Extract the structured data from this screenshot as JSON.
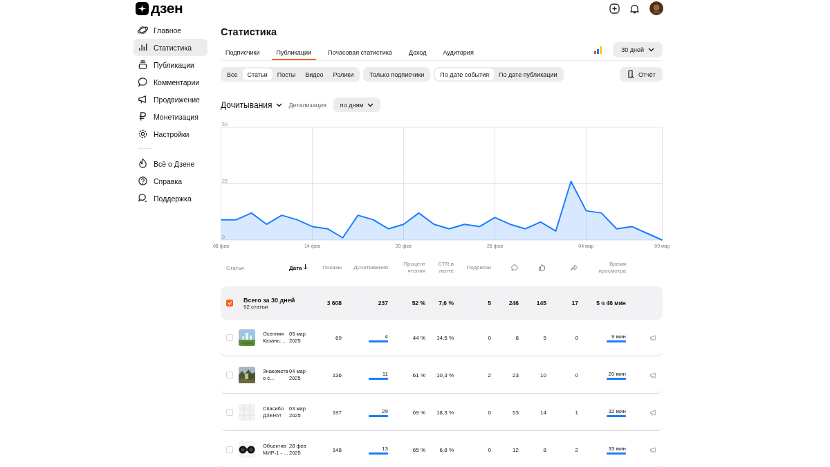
{
  "header": {
    "logo": "дзен"
  },
  "sidebar": {
    "items": [
      {
        "label": "Главное",
        "selected": false
      },
      {
        "label": "Статистика",
        "selected": true
      },
      {
        "label": "Публикации",
        "selected": false
      },
      {
        "label": "Комментарии",
        "selected": false
      },
      {
        "label": "Продвижение",
        "selected": false
      },
      {
        "label": "Монетизация",
        "selected": false
      },
      {
        "label": "Настройки",
        "selected": false
      }
    ],
    "footer_items": [
      {
        "label": "Всё о Дзене"
      },
      {
        "label": "Справка"
      },
      {
        "label": "Поддержка"
      }
    ]
  },
  "title": "Статистика",
  "tabs": [
    {
      "label": "Подписчики",
      "selected": false
    },
    {
      "label": "Публикации",
      "selected": true
    },
    {
      "label": "Почасовая статистика",
      "selected": false
    },
    {
      "label": "Доход",
      "selected": false
    },
    {
      "label": "Аудитория",
      "selected": false
    }
  ],
  "period": "30 дней",
  "type_filter": [
    {
      "label": "Все",
      "selected": false
    },
    {
      "label": "Статьи",
      "selected": true
    },
    {
      "label": "Посты",
      "selected": false
    },
    {
      "label": "Видео",
      "selected": false
    },
    {
      "label": "Ролики",
      "selected": false
    }
  ],
  "subscribers_only": {
    "label": "Только подписчики",
    "selected": false
  },
  "date_mode": [
    {
      "label": "По дате события",
      "selected": true
    },
    {
      "label": "По дате публикации",
      "selected": false
    }
  ],
  "report_button": "Отчёт",
  "metric": "Дочитывания",
  "detail_label": "Детализация",
  "detail_value": "по дням",
  "chart_data": {
    "type": "area",
    "categories": [
      "08 фев",
      null,
      null,
      null,
      null,
      null,
      "14 фев",
      null,
      null,
      null,
      null,
      null,
      "20 фев",
      null,
      null,
      null,
      null,
      null,
      "26 фев",
      null,
      null,
      null,
      null,
      null,
      "04 мар",
      null,
      null,
      null,
      null,
      "09 мар"
    ],
    "series": [
      {
        "color": "#1a7cff",
        "values": [
          9,
          9,
          12,
          7,
          11,
          9,
          6,
          5,
          1,
          11,
          9,
          5,
          7,
          12,
          7,
          5,
          7,
          6,
          10,
          7,
          5,
          8,
          4,
          26,
          13,
          12,
          5,
          6,
          3,
          0
        ]
      }
    ],
    "ylim": [
      0,
      50
    ],
    "yticks": [
      0,
      25,
      50
    ],
    "grid": true
  },
  "table": {
    "columns": [
      "Статья",
      "Дата",
      "Показы",
      "Дочитывания",
      "Процент чтения",
      "CTR в ленте",
      "Подписки"
    ],
    "time_column": "Время просмотра",
    "total": {
      "title": "Всего за 30 дней",
      "subtitle": "92 статьи",
      "checked": true,
      "values": [
        "3 608",
        "237",
        "52 %",
        "7,6 %",
        "5",
        "246",
        "145",
        "17",
        "5 ч 46 мин"
      ]
    },
    "rows": [
      {
        "title": "Осенняя Казань:...",
        "date": "05 мар 2025",
        "checked": false,
        "values": [
          "69",
          "4",
          "44 %",
          "14,5 %",
          "0",
          "8",
          "5",
          "0",
          "9 мин"
        ]
      },
      {
        "title": "Знакомств о с...",
        "date": "04 мар 2025",
        "checked": false,
        "values": [
          "136",
          "11",
          "61 %",
          "10,3 %",
          "2",
          "23",
          "10",
          "0",
          "20 мин"
        ]
      },
      {
        "title": "Спасибо ДЗЕНУ!",
        "date": "03 мар 2025",
        "checked": false,
        "values": [
          "197",
          "29",
          "69 %",
          "18,3 %",
          "0",
          "53",
          "14",
          "1",
          "32 мин"
        ]
      },
      {
        "title": "Объектив МИР-1 - ...",
        "date": "28 фев 2025",
        "checked": false,
        "values": [
          "148",
          "13",
          "65 %",
          "6,8 %",
          "0",
          "12",
          "8",
          "2",
          "33 мин"
        ]
      }
    ]
  }
}
